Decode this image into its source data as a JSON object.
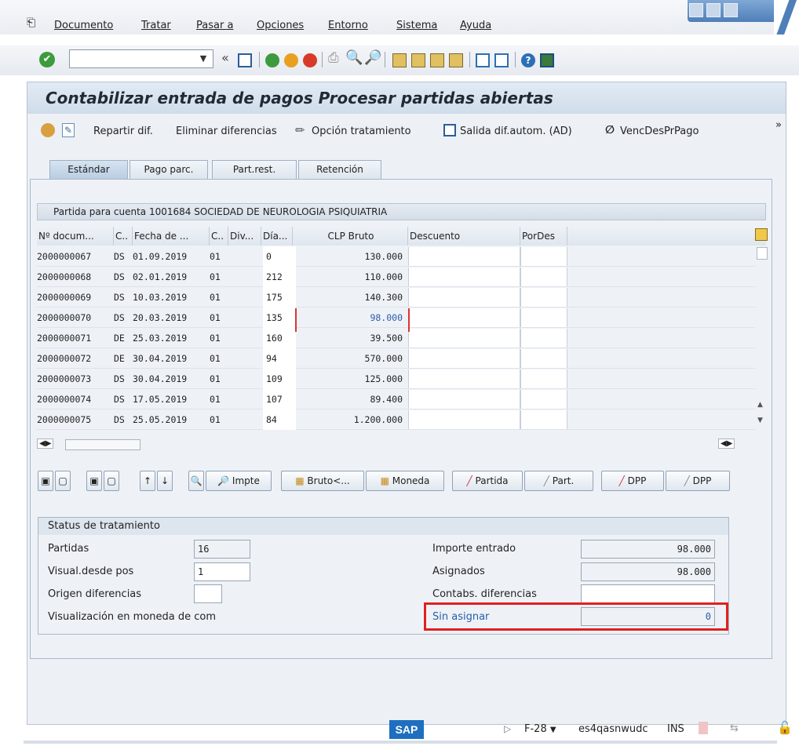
{
  "menubar": {
    "items": [
      "Documento",
      "Tratar",
      "Pasar a",
      "Opciones",
      "Entorno",
      "Sistema",
      "Ayuda"
    ]
  },
  "toolbar": {
    "command_value": "",
    "icons": [
      "enter-icon",
      "back-arrows-icon",
      "save-icon",
      "back-icon",
      "exit-icon",
      "cancel-icon",
      "print-icon",
      "find-icon",
      "find-next-icon",
      "first-page-icon",
      "prev-page-icon",
      "next-page-icon",
      "last-page-icon",
      "create-session-icon",
      "shortcut-icon",
      "help-icon",
      "customize-layout-icon"
    ]
  },
  "screen": {
    "title": "Contabilizar entrada de pagos Procesar partidas abiertas"
  },
  "app_toolbar": {
    "repartir": "Repartir dif.",
    "eliminar": "Eliminar diferencias",
    "opcion": "Opción tratamiento",
    "salida": "Salida dif.autom. (AD)",
    "venc": "VencDesPrPago",
    "more": "»"
  },
  "tabs": [
    "Estándar",
    "Pago parc.",
    "Part.rest.",
    "Retención"
  ],
  "table": {
    "title": "Partida para cuenta 1001684 SOCIEDAD DE NEUROLOGIA PSIQUIATRIA",
    "headers": [
      "Nº docum...",
      "C..",
      "Fecha de ...",
      "C..",
      "Div...",
      "Día...",
      "CLP Bruto",
      "Descuento",
      "PorDes"
    ],
    "rows": [
      {
        "doc": "2000000067",
        "cl": "DS",
        "fecha": "01.09.2019",
        "c": "01",
        "div": "",
        "dia": "0",
        "bruto": "130.000"
      },
      {
        "doc": "2000000068",
        "cl": "DS",
        "fecha": "02.01.2019",
        "c": "01",
        "div": "",
        "dia": "212",
        "bruto": "110.000"
      },
      {
        "doc": "2000000069",
        "cl": "DS",
        "fecha": "10.03.2019",
        "c": "01",
        "div": "",
        "dia": "175",
        "bruto": "140.300"
      },
      {
        "doc": "2000000070",
        "cl": "DS",
        "fecha": "20.03.2019",
        "c": "01",
        "div": "",
        "dia": "135",
        "bruto": "98.000"
      },
      {
        "doc": "2000000071",
        "cl": "DE",
        "fecha": "25.03.2019",
        "c": "01",
        "div": "",
        "dia": "160",
        "bruto": "39.500"
      },
      {
        "doc": "2000000072",
        "cl": "DE",
        "fecha": "30.04.2019",
        "c": "01",
        "div": "",
        "dia": "94",
        "bruto": "570.000"
      },
      {
        "doc": "2000000073",
        "cl": "DS",
        "fecha": "30.04.2019",
        "c": "01",
        "div": "",
        "dia": "109",
        "bruto": "125.000"
      },
      {
        "doc": "2000000074",
        "cl": "DS",
        "fecha": "17.05.2019",
        "c": "01",
        "div": "",
        "dia": "107",
        "bruto": "89.400"
      },
      {
        "doc": "2000000075",
        "cl": "DS",
        "fecha": "25.05.2019",
        "c": "01",
        "div": "",
        "dia": "84",
        "bruto": "1.200.000"
      }
    ]
  },
  "buttons": {
    "impte": "Impte",
    "bruto": "Bruto<...",
    "moneda": "Moneda",
    "partida": "Partida",
    "part": "Part.",
    "dpp1": "DPP",
    "dpp2": "DPP"
  },
  "status": {
    "title": "Status de tratamiento",
    "partidas_label": "Partidas",
    "partidas_value": "16",
    "visual_label": "Visual.desde pos",
    "visual_value": "1",
    "origen_label": "Origen diferencias",
    "origen_value": "",
    "moneda_label": "Visualización en moneda de com",
    "importe_label": "Importe entrado",
    "importe_value": "98.000",
    "asignados_label": "Asignados",
    "asignados_value": "98.000",
    "contabs_label": "Contabs. diferencias",
    "contabs_value": "",
    "sin_label": "Sin asignar",
    "sin_value": "0"
  },
  "statusbar": {
    "logo": "SAP",
    "tcode": "F-28",
    "server": "es4qasnwudc",
    "mode": "INS"
  },
  "colors": {
    "accent": "#1e6fbf",
    "highlight_box": "#e02020",
    "link_text": "#2a5caa"
  }
}
